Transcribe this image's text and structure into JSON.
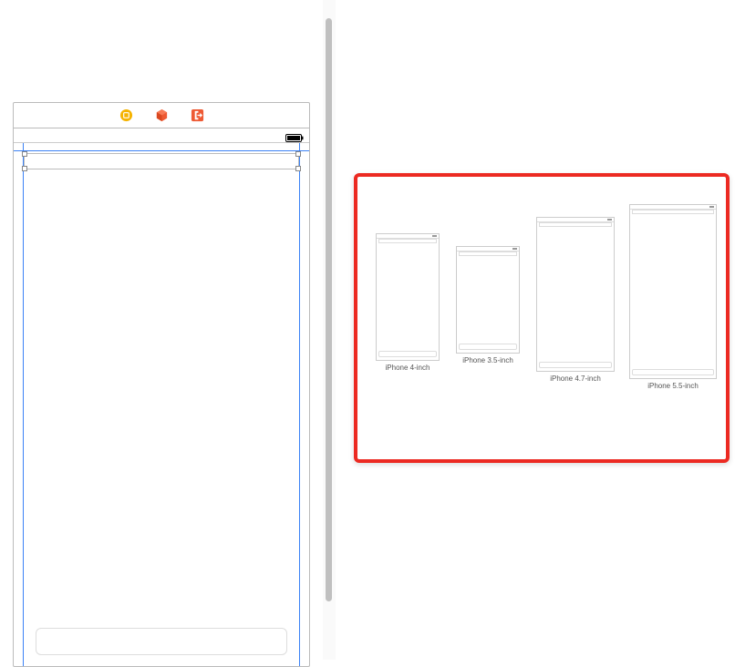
{
  "toolbar": {
    "icons": {
      "stack": "stack-icon",
      "cube": "cube-icon",
      "exit": "exit-segue-icon"
    }
  },
  "status_bar": {
    "battery": "battery-full"
  },
  "previews": {
    "items": [
      {
        "label": "iPhone 4-inch"
      },
      {
        "label": "iPhone 3.5-inch"
      },
      {
        "label": "iPhone 4.7-inch"
      },
      {
        "label": "iPhone 5.5-inch"
      }
    ]
  }
}
